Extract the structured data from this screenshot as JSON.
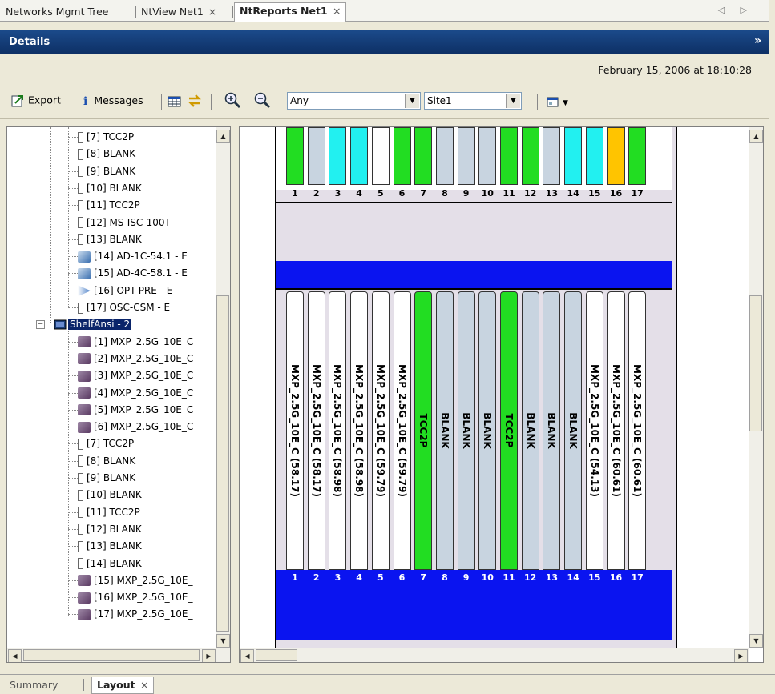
{
  "tabs": [
    {
      "label": "Networks Mgmt Tree",
      "active": false
    },
    {
      "label": "NtView Net1",
      "active": false
    },
    {
      "label": "NtReports Net1",
      "active": true
    }
  ],
  "tab_close": "×",
  "tab_nav": "◁ ▷",
  "details": {
    "title": "Details",
    "collapse_glyph": "»"
  },
  "timestamp": "February 15, 2006 at 18:10:28",
  "toolbar": {
    "export_label": "Export",
    "messages_label": "Messages",
    "filter_value": "Any",
    "site_value": "Site1"
  },
  "tree": {
    "items": [
      {
        "label": "[7] TCC2P",
        "icon": "card-icon"
      },
      {
        "label": "[8] BLANK",
        "icon": "card-icon"
      },
      {
        "label": "[9] BLANK",
        "icon": "card-icon"
      },
      {
        "label": "[10] BLANK",
        "icon": "card-icon"
      },
      {
        "label": "[11] TCC2P",
        "icon": "card-icon"
      },
      {
        "label": "[12] MS-ISC-100T",
        "icon": "card-icon"
      },
      {
        "label": "[13] BLANK",
        "icon": "card-icon"
      },
      {
        "label": "[14] AD-1C-54.1 - E",
        "icon": "add-drop-icon"
      },
      {
        "label": "[15] AD-4C-58.1 - E",
        "icon": "add-drop-icon"
      },
      {
        "label": "[16] OPT-PRE - E",
        "icon": "amplifier-icon"
      },
      {
        "label": "[17] OSC-CSM - E",
        "icon": "card-icon"
      }
    ],
    "shelf_label": "ShelfAnsi - 2",
    "shelf_items": [
      {
        "label": "[1] MXP_2.5G_10E_C",
        "icon": "transponder-icon"
      },
      {
        "label": "[2] MXP_2.5G_10E_C",
        "icon": "transponder-icon"
      },
      {
        "label": "[3] MXP_2.5G_10E_C",
        "icon": "transponder-icon"
      },
      {
        "label": "[4] MXP_2.5G_10E_C",
        "icon": "transponder-icon"
      },
      {
        "label": "[5] MXP_2.5G_10E_C",
        "icon": "transponder-icon"
      },
      {
        "label": "[6] MXP_2.5G_10E_C",
        "icon": "transponder-icon"
      },
      {
        "label": "[7] TCC2P",
        "icon": "card-icon"
      },
      {
        "label": "[8] BLANK",
        "icon": "card-icon"
      },
      {
        "label": "[9] BLANK",
        "icon": "card-icon"
      },
      {
        "label": "[10] BLANK",
        "icon": "card-icon"
      },
      {
        "label": "[11] TCC2P",
        "icon": "card-icon"
      },
      {
        "label": "[12] BLANK",
        "icon": "card-icon"
      },
      {
        "label": "[13] BLANK",
        "icon": "card-icon"
      },
      {
        "label": "[14] BLANK",
        "icon": "card-icon"
      },
      {
        "label": "[15] MXP_2.5G_10E_",
        "icon": "transponder-icon"
      },
      {
        "label": "[16] MXP_2.5G_10E_",
        "icon": "transponder-icon"
      },
      {
        "label": "[17] MXP_2.5G_10E_",
        "icon": "transponder-icon"
      }
    ]
  },
  "shelf_top": {
    "slot_numbers": [
      "1",
      "2",
      "3",
      "4",
      "5",
      "6",
      "7",
      "8",
      "9",
      "10",
      "11",
      "12",
      "13",
      "14",
      "15",
      "16",
      "17"
    ],
    "slot_colors": [
      "#22dd22",
      "#c8d4e0",
      "#22f0f0",
      "#22f0f0",
      "#ffffff",
      "#22dd22",
      "#22dd22",
      "#c8d4e0",
      "#c8d4e0",
      "#c8d4e0",
      "#22dd22",
      "#22dd22",
      "#c8d4e0",
      "#22f0f0",
      "#22f0f0",
      "#ffc400",
      "#22dd22"
    ]
  },
  "shelf_bottom": {
    "slot_numbers": [
      "1",
      "2",
      "3",
      "4",
      "5",
      "6",
      "7",
      "8",
      "9",
      "10",
      "11",
      "12",
      "13",
      "14",
      "15",
      "16",
      "17"
    ],
    "cards": [
      {
        "label": "MXP_2.5G_10E_C (58.17)",
        "color": "#ffffff"
      },
      {
        "label": "MXP_2.5G_10E_C (58.17)",
        "color": "#ffffff"
      },
      {
        "label": "MXP_2.5G_10E_C (58.98)",
        "color": "#ffffff"
      },
      {
        "label": "MXP_2.5G_10E_C (58.98)",
        "color": "#ffffff"
      },
      {
        "label": "MXP_2.5G_10E_C (59.79)",
        "color": "#ffffff"
      },
      {
        "label": "MXP_2.5G_10E_C (59.79)",
        "color": "#ffffff"
      },
      {
        "label": "TCC2P",
        "color": "#22dd22"
      },
      {
        "label": "BLANK",
        "color": "#c8d4e0"
      },
      {
        "label": "BLANK",
        "color": "#c8d4e0"
      },
      {
        "label": "BLANK",
        "color": "#c8d4e0"
      },
      {
        "label": "TCC2P",
        "color": "#22dd22"
      },
      {
        "label": "BLANK",
        "color": "#c8d4e0"
      },
      {
        "label": "BLANK",
        "color": "#c8d4e0"
      },
      {
        "label": "BLANK",
        "color": "#c8d4e0"
      },
      {
        "label": "MXP_2.5G_10E_C (54.13)",
        "color": "#ffffff"
      },
      {
        "label": "MXP_2.5G_10E_C (60.61)",
        "color": "#ffffff"
      },
      {
        "label": "MXP_2.5G_10E_C (60.61)",
        "color": "#ffffff"
      }
    ]
  },
  "bottom_tabs": [
    {
      "label": "Summary",
      "active": false
    },
    {
      "label": "Layout",
      "active": true
    }
  ],
  "colors": {
    "header_blue": "#0d3a7a",
    "shelf_blue": "#0a14f0",
    "selection": "#0a246a"
  }
}
